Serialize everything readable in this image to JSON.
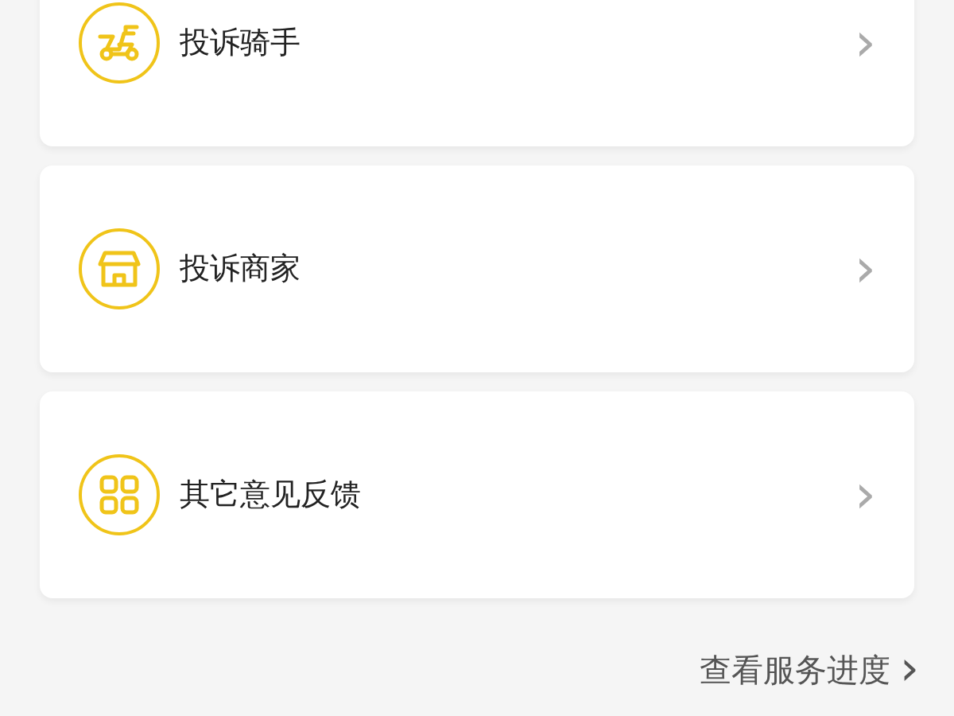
{
  "menu_items": [
    {
      "kind": "scooter",
      "label": "投诉骑手",
      "chevron": "›"
    },
    {
      "kind": "shop",
      "label": "投诉商家",
      "chevron": "›"
    },
    {
      "kind": "grid",
      "label": "其它意见反馈",
      "chevron": "›"
    }
  ],
  "progress_link": {
    "label": "查看服务进度",
    "chevron": "›"
  }
}
